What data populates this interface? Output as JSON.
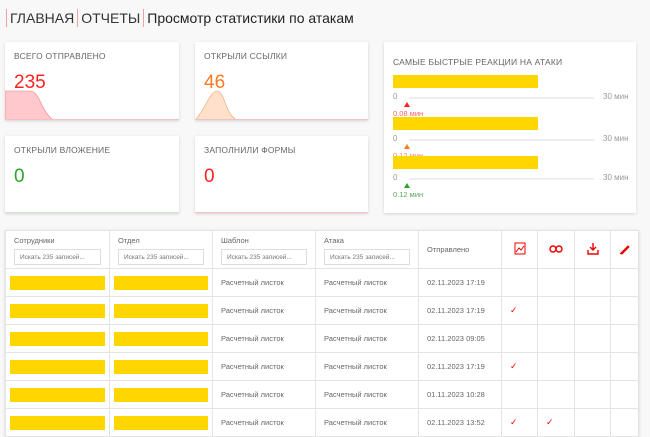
{
  "breadcrumb": [
    "ГЛАВНАЯ",
    "ОТЧЕТЫ",
    "Просмотр статистики по атакам"
  ],
  "stats": [
    {
      "title": "ВСЕГО ОТПРАВЛЕНО",
      "value": "235",
      "color": "#ff2020"
    },
    {
      "title": "ОТКРЫЛИ ССЫЛКИ",
      "value": "46",
      "color": "#ff7a20"
    },
    {
      "title": "ОТКРЫЛИ ВЛОЖЕНИЕ",
      "value": "0",
      "color": "#2aa52a"
    },
    {
      "title": "ЗАПОЛНИЛИ ФОРМЫ",
      "value": "0",
      "color": "#ff2020"
    }
  ],
  "reactions": {
    "title": "САМЫЕ БЫСТРЫЕ РЕАКЦИИ НА АТАКИ",
    "min": "0",
    "max": "30 мин",
    "items": [
      {
        "value": "0.08 мин",
        "color": "#ff2020"
      },
      {
        "value": "0.12 мин",
        "color": "#ff7a20"
      },
      {
        "value": "0.12 мин",
        "color": "#2aa52a"
      }
    ]
  },
  "table": {
    "headers": [
      "Сотрудники",
      "Отдел",
      "Шаблон",
      "Атака",
      "Отправлено"
    ],
    "search_placeholder": "Искать 235 записей...",
    "icon_columns": [
      "image-icon",
      "link-icon",
      "download-icon",
      "pencil-icon"
    ],
    "check": "✓",
    "rows": [
      {
        "template": "Расчетный листок",
        "attack": "Расчетный листок",
        "sent": "02.11.2023 17:19",
        "flags": [
          false,
          false,
          false,
          false
        ]
      },
      {
        "template": "Расчетный листок",
        "attack": "Расчетный листок",
        "sent": "02.11.2023 17:19",
        "flags": [
          true,
          false,
          false,
          false
        ]
      },
      {
        "template": "Расчетный листок",
        "attack": "Расчетный листок",
        "sent": "02.11.2023 09:05",
        "flags": [
          false,
          false,
          false,
          false
        ]
      },
      {
        "template": "Расчетный листок",
        "attack": "Расчетный листок",
        "sent": "02.11.2023 17:19",
        "flags": [
          true,
          false,
          false,
          false
        ]
      },
      {
        "template": "Расчетный листок",
        "attack": "Расчетный листок",
        "sent": "01.11.2023 10:28",
        "flags": [
          false,
          false,
          false,
          false
        ]
      },
      {
        "template": "Расчетный листок",
        "attack": "Расчетный листок",
        "sent": "02.11.2023 13:52",
        "flags": [
          true,
          true,
          false,
          false
        ]
      }
    ]
  }
}
